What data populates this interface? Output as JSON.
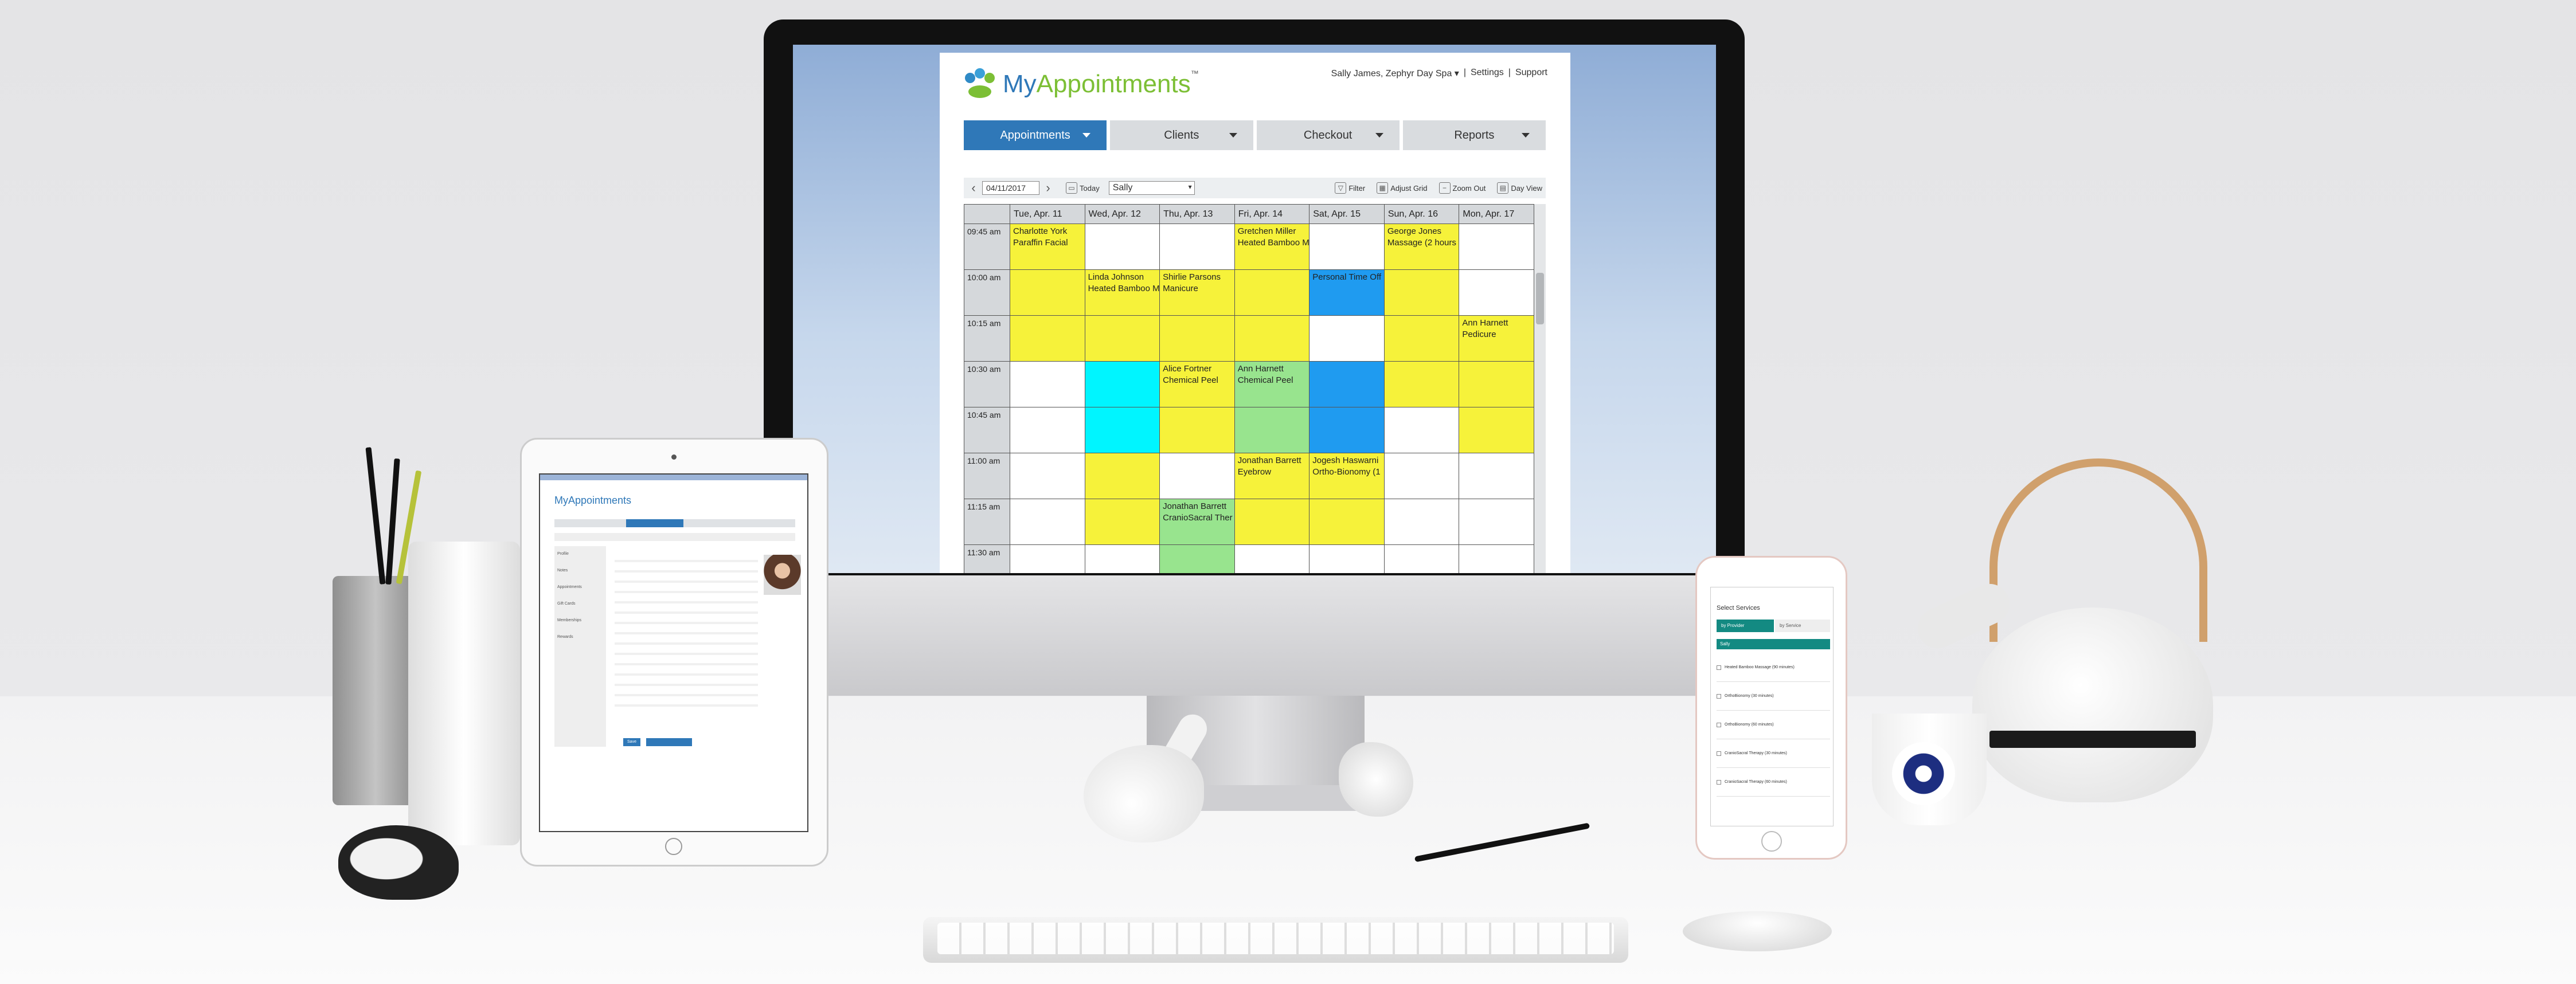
{
  "app": {
    "logo_text_a": "My",
    "logo_text_b": "Appointments",
    "logo_tm": "™",
    "user": "Sally James, Zephyr Day Spa",
    "user_caret": "▾",
    "sep": "|",
    "settings": "Settings",
    "support": "Support",
    "tabs": [
      {
        "label": "Appointments"
      },
      {
        "label": "Clients"
      },
      {
        "label": "Checkout"
      },
      {
        "label": "Reports"
      }
    ],
    "toolbar": {
      "date": "04/11/2017",
      "today": "Today",
      "staff": "Sally",
      "filter": "Filter",
      "adjust_grid": "Adjust Grid",
      "zoom_out": "Zoom Out",
      "day_view": "Day View"
    },
    "days": [
      "Tue, Apr. 11",
      "Wed, Apr. 12",
      "Thu, Apr. 13",
      "Fri, Apr. 14",
      "Sat, Apr. 15",
      "Sun, Apr. 16",
      "Mon, Apr. 17"
    ],
    "times": [
      "09:45 am",
      "10:00 am",
      "10:15 am",
      "10:30 am",
      "10:45 am",
      "11:00 am",
      "11:15 am",
      "11:30 am"
    ],
    "cells": [
      [
        [
          "y",
          "Charlotte York",
          "Paraffin Facial"
        ],
        [
          "w",
          "",
          ""
        ],
        [
          "w",
          "",
          ""
        ],
        [
          "y",
          "Gretchen Miller",
          "Heated Bamboo M"
        ],
        [
          "w",
          "",
          ""
        ],
        [
          "y",
          "George Jones",
          "Massage (2 hours"
        ],
        [
          "w",
          "",
          ""
        ]
      ],
      [
        [
          "y",
          "",
          ""
        ],
        [
          "y",
          "Linda Johnson",
          "Heated Bamboo M"
        ],
        [
          "y",
          "Shirlie Parsons",
          "Manicure"
        ],
        [
          "y",
          "",
          ""
        ],
        [
          "b",
          "Personal Time Off",
          ""
        ],
        [
          "y",
          "",
          ""
        ],
        [
          "w",
          "",
          ""
        ]
      ],
      [
        [
          "y",
          "",
          ""
        ],
        [
          "y",
          "",
          ""
        ],
        [
          "y",
          "",
          ""
        ],
        [
          "y",
          "",
          ""
        ],
        [
          "w",
          "",
          ""
        ],
        [
          "y",
          "",
          ""
        ],
        [
          "y",
          "Ann Harnett",
          "Pedicure"
        ]
      ],
      [
        [
          "w",
          "",
          ""
        ],
        [
          "c",
          "",
          ""
        ],
        [
          "y",
          "Alice Fortner",
          "Chemical Peel"
        ],
        [
          "g",
          "Ann Harnett",
          "Chemical Peel"
        ],
        [
          "b",
          "",
          ""
        ],
        [
          "y",
          "",
          ""
        ],
        [
          "y",
          "",
          ""
        ]
      ],
      [
        [
          "w",
          "",
          ""
        ],
        [
          "c",
          "",
          ""
        ],
        [
          "y",
          "",
          ""
        ],
        [
          "g",
          "",
          ""
        ],
        [
          "b",
          "",
          ""
        ],
        [
          "w",
          "",
          ""
        ],
        [
          "y",
          "",
          ""
        ]
      ],
      [
        [
          "w",
          "",
          ""
        ],
        [
          "y",
          "",
          ""
        ],
        [
          "w",
          "",
          ""
        ],
        [
          "y",
          "Jonathan Barrett",
          "Eyebrow"
        ],
        [
          "y",
          "Jogesh Haswarni",
          "Ortho-Bionomy (1"
        ],
        [
          "w",
          "",
          ""
        ],
        [
          "w",
          "",
          ""
        ]
      ],
      [
        [
          "w",
          "",
          ""
        ],
        [
          "y",
          "",
          ""
        ],
        [
          "g",
          "Jonathan Barrett",
          "CranioSacral Ther"
        ],
        [
          "y",
          "",
          ""
        ],
        [
          "y",
          "",
          ""
        ],
        [
          "w",
          "",
          ""
        ],
        [
          "w",
          "",
          ""
        ]
      ],
      [
        [
          "w",
          "",
          ""
        ],
        [
          "w",
          "",
          ""
        ],
        [
          "g",
          "",
          ""
        ],
        [
          "w",
          "",
          ""
        ],
        [
          "w",
          "",
          ""
        ],
        [
          "w",
          "",
          ""
        ],
        [
          "w",
          "",
          ""
        ]
      ]
    ]
  },
  "ipad": {
    "logo": "MyAppointments",
    "fields": [
      "Profile",
      "Notes",
      "Appointments",
      "Gift Cards",
      "Memberships",
      "Rewards"
    ],
    "button": "Save"
  },
  "iphone": {
    "title": "Select Services",
    "tab_a": "by Provider",
    "tab_b": "by Service",
    "provider": "Sally",
    "services": [
      "Heated Bamboo Massage (90 minutes)",
      "OrthoBionomy (30 minutes)",
      "OrthoBionomy (60 minutes)",
      "CranioSacral Therapy (30 minutes)",
      "CranioSacral Therapy (60 minutes)"
    ]
  },
  "colors": {
    "y": "#f6f23a",
    "c": "#00f5ff",
    "b": "#1f9bf0",
    "g": "#98e48e",
    "accent": "#2f78b8",
    "leaf": "#7cbf35",
    "teal": "#138a82"
  }
}
